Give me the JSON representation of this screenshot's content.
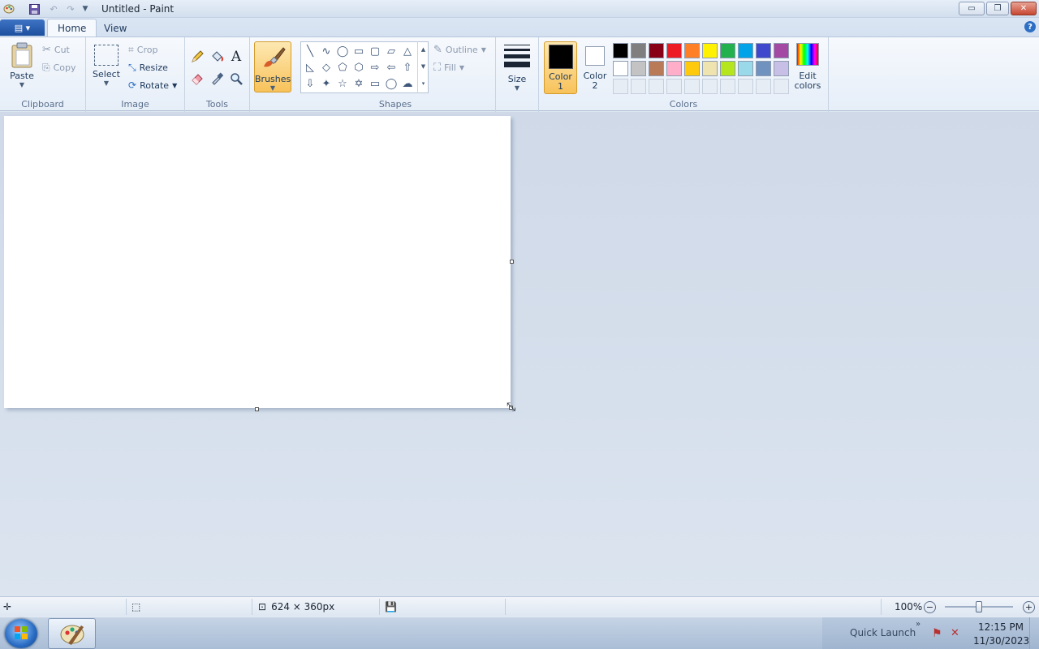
{
  "window": {
    "title": "Untitled - Paint",
    "minimize_glyph": "▭",
    "restore_glyph": "❐",
    "close_glyph": "✕"
  },
  "qat": {
    "app_icon": "paint-app-icon",
    "save_icon": "save-icon",
    "undo_icon": "undo-icon",
    "redo_icon": "redo-icon",
    "customize_icon": "chevron-down-icon"
  },
  "tabs": [
    {
      "label": "Home",
      "selected": true
    },
    {
      "label": "View",
      "selected": false
    }
  ],
  "app_menu": {
    "glyph": "▤ ▾"
  },
  "help_glyph": "?",
  "clipboard": {
    "label": "Clipboard",
    "paste_label": "Paste",
    "cut_label": "Cut",
    "copy_label": "Copy"
  },
  "image": {
    "label": "Image",
    "select_label": "Select",
    "crop_label": "Crop",
    "resize_label": "Resize",
    "rotate_label": "Rotate"
  },
  "tools": {
    "label": "Tools",
    "items": [
      "pencil-icon",
      "fill-bucket-icon",
      "text-icon",
      "eraser-icon",
      "color-picker-icon",
      "magnifier-icon"
    ],
    "text_glyph": "A"
  },
  "brushes": {
    "label": "Brushes"
  },
  "shapes": {
    "label": "Shapes",
    "outline_label": "Outline",
    "fill_label": "Fill",
    "glyphs": [
      "╲",
      "∿",
      "◯",
      "▭",
      "▢",
      "⏥",
      "△",
      "◺",
      "◇",
      "⬠",
      "⬡",
      "⇨",
      "⇦",
      "⇧",
      "⇩",
      "✦",
      "☆",
      "✡",
      "▭",
      "◯",
      "☁"
    ]
  },
  "size": {
    "label": "Size"
  },
  "colors": {
    "label": "Colors",
    "color1_label": "Color\n1",
    "color1_line1": "Color",
    "color1_line2": "1",
    "color2_line1": "Color",
    "color2_line2": "2",
    "color1_value": "#000000",
    "color2_value": "#ffffff",
    "edit_line1": "Edit",
    "edit_line2": "colors",
    "palette_row1": [
      "#000000",
      "#7f7f7f",
      "#880015",
      "#ed1c24",
      "#ff7f27",
      "#fff200",
      "#22b14c",
      "#00a2e8",
      "#3f48cc",
      "#a349a4"
    ],
    "palette_row2": [
      "#ffffff",
      "#c3c3c3",
      "#b97a57",
      "#ffaec9",
      "#ffc90e",
      "#efe4b0",
      "#b5e61d",
      "#99d9ea",
      "#7092be",
      "#c8bfe7"
    ]
  },
  "status": {
    "canvas_size": "624 × 360px",
    "zoom": "100%",
    "zoom_fraction": 0.5
  },
  "taskbar": {
    "quick_launch": "Quick Launch",
    "time": "12:15 PM",
    "date": "11/30/2023"
  }
}
